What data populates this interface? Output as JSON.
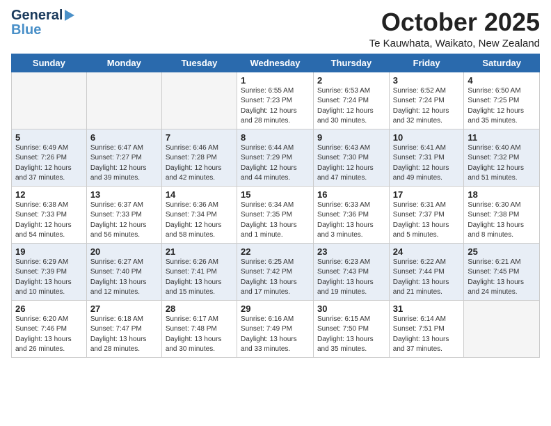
{
  "header": {
    "logo_general": "General",
    "logo_blue": "Blue",
    "month_title": "October 2025",
    "location": "Te Kauwhata, Waikato, New Zealand"
  },
  "weekdays": [
    "Sunday",
    "Monday",
    "Tuesday",
    "Wednesday",
    "Thursday",
    "Friday",
    "Saturday"
  ],
  "weeks": [
    [
      {
        "day": "",
        "info": ""
      },
      {
        "day": "",
        "info": ""
      },
      {
        "day": "",
        "info": ""
      },
      {
        "day": "1",
        "info": "Sunrise: 6:55 AM\nSunset: 7:23 PM\nDaylight: 12 hours\nand 28 minutes."
      },
      {
        "day": "2",
        "info": "Sunrise: 6:53 AM\nSunset: 7:24 PM\nDaylight: 12 hours\nand 30 minutes."
      },
      {
        "day": "3",
        "info": "Sunrise: 6:52 AM\nSunset: 7:24 PM\nDaylight: 12 hours\nand 32 minutes."
      },
      {
        "day": "4",
        "info": "Sunrise: 6:50 AM\nSunset: 7:25 PM\nDaylight: 12 hours\nand 35 minutes."
      }
    ],
    [
      {
        "day": "5",
        "info": "Sunrise: 6:49 AM\nSunset: 7:26 PM\nDaylight: 12 hours\nand 37 minutes."
      },
      {
        "day": "6",
        "info": "Sunrise: 6:47 AM\nSunset: 7:27 PM\nDaylight: 12 hours\nand 39 minutes."
      },
      {
        "day": "7",
        "info": "Sunrise: 6:46 AM\nSunset: 7:28 PM\nDaylight: 12 hours\nand 42 minutes."
      },
      {
        "day": "8",
        "info": "Sunrise: 6:44 AM\nSunset: 7:29 PM\nDaylight: 12 hours\nand 44 minutes."
      },
      {
        "day": "9",
        "info": "Sunrise: 6:43 AM\nSunset: 7:30 PM\nDaylight: 12 hours\nand 47 minutes."
      },
      {
        "day": "10",
        "info": "Sunrise: 6:41 AM\nSunset: 7:31 PM\nDaylight: 12 hours\nand 49 minutes."
      },
      {
        "day": "11",
        "info": "Sunrise: 6:40 AM\nSunset: 7:32 PM\nDaylight: 12 hours\nand 51 minutes."
      }
    ],
    [
      {
        "day": "12",
        "info": "Sunrise: 6:38 AM\nSunset: 7:33 PM\nDaylight: 12 hours\nand 54 minutes."
      },
      {
        "day": "13",
        "info": "Sunrise: 6:37 AM\nSunset: 7:33 PM\nDaylight: 12 hours\nand 56 minutes."
      },
      {
        "day": "14",
        "info": "Sunrise: 6:36 AM\nSunset: 7:34 PM\nDaylight: 12 hours\nand 58 minutes."
      },
      {
        "day": "15",
        "info": "Sunrise: 6:34 AM\nSunset: 7:35 PM\nDaylight: 13 hours\nand 1 minute."
      },
      {
        "day": "16",
        "info": "Sunrise: 6:33 AM\nSunset: 7:36 PM\nDaylight: 13 hours\nand 3 minutes."
      },
      {
        "day": "17",
        "info": "Sunrise: 6:31 AM\nSunset: 7:37 PM\nDaylight: 13 hours\nand 5 minutes."
      },
      {
        "day": "18",
        "info": "Sunrise: 6:30 AM\nSunset: 7:38 PM\nDaylight: 13 hours\nand 8 minutes."
      }
    ],
    [
      {
        "day": "19",
        "info": "Sunrise: 6:29 AM\nSunset: 7:39 PM\nDaylight: 13 hours\nand 10 minutes."
      },
      {
        "day": "20",
        "info": "Sunrise: 6:27 AM\nSunset: 7:40 PM\nDaylight: 13 hours\nand 12 minutes."
      },
      {
        "day": "21",
        "info": "Sunrise: 6:26 AM\nSunset: 7:41 PM\nDaylight: 13 hours\nand 15 minutes."
      },
      {
        "day": "22",
        "info": "Sunrise: 6:25 AM\nSunset: 7:42 PM\nDaylight: 13 hours\nand 17 minutes."
      },
      {
        "day": "23",
        "info": "Sunrise: 6:23 AM\nSunset: 7:43 PM\nDaylight: 13 hours\nand 19 minutes."
      },
      {
        "day": "24",
        "info": "Sunrise: 6:22 AM\nSunset: 7:44 PM\nDaylight: 13 hours\nand 21 minutes."
      },
      {
        "day": "25",
        "info": "Sunrise: 6:21 AM\nSunset: 7:45 PM\nDaylight: 13 hours\nand 24 minutes."
      }
    ],
    [
      {
        "day": "26",
        "info": "Sunrise: 6:20 AM\nSunset: 7:46 PM\nDaylight: 13 hours\nand 26 minutes."
      },
      {
        "day": "27",
        "info": "Sunrise: 6:18 AM\nSunset: 7:47 PM\nDaylight: 13 hours\nand 28 minutes."
      },
      {
        "day": "28",
        "info": "Sunrise: 6:17 AM\nSunset: 7:48 PM\nDaylight: 13 hours\nand 30 minutes."
      },
      {
        "day": "29",
        "info": "Sunrise: 6:16 AM\nSunset: 7:49 PM\nDaylight: 13 hours\nand 33 minutes."
      },
      {
        "day": "30",
        "info": "Sunrise: 6:15 AM\nSunset: 7:50 PM\nDaylight: 13 hours\nand 35 minutes."
      },
      {
        "day": "31",
        "info": "Sunrise: 6:14 AM\nSunset: 7:51 PM\nDaylight: 13 hours\nand 37 minutes."
      },
      {
        "day": "",
        "info": ""
      }
    ]
  ]
}
